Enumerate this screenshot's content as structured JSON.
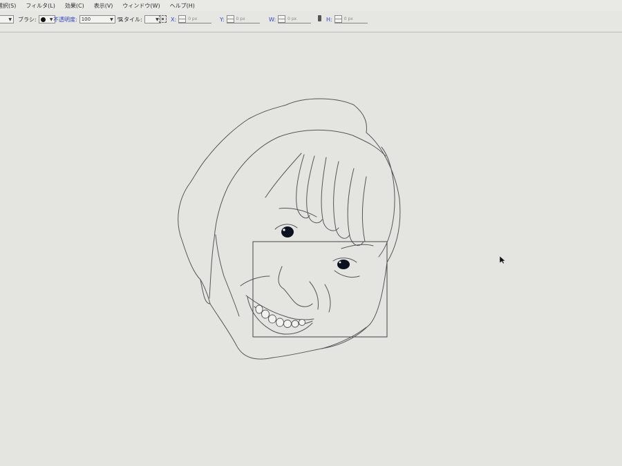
{
  "menu": {
    "items": [
      "選択(S)",
      "フィルタ(L)",
      "効果(C)",
      "表示(V)",
      "ウィンドウ(W)",
      "ヘルプ(H)"
    ]
  },
  "toolbar": {
    "brush_label": "ブラシ:",
    "opacity_label": "不透明度:",
    "opacity_value": "100",
    "opacity_unit": "%",
    "style_label": "スタイル:",
    "x_label": "X:",
    "y_label": "Y:",
    "w_label": "W:",
    "h_label": "H:",
    "x_value": "0 px",
    "y_value": "0 px",
    "w_value": "0 px",
    "h_value": "0 px"
  },
  "icons": {
    "dropdown": "chevron-down-icon",
    "brush": "brush-dot-icon",
    "grid": "selection-grid-icon",
    "lock": "lock-icon",
    "cursor": "mouse-pointer-icon"
  },
  "colors": {
    "canvas": "#e4e4e0",
    "stroke": "#555555",
    "label_accent": "#3344c4"
  }
}
